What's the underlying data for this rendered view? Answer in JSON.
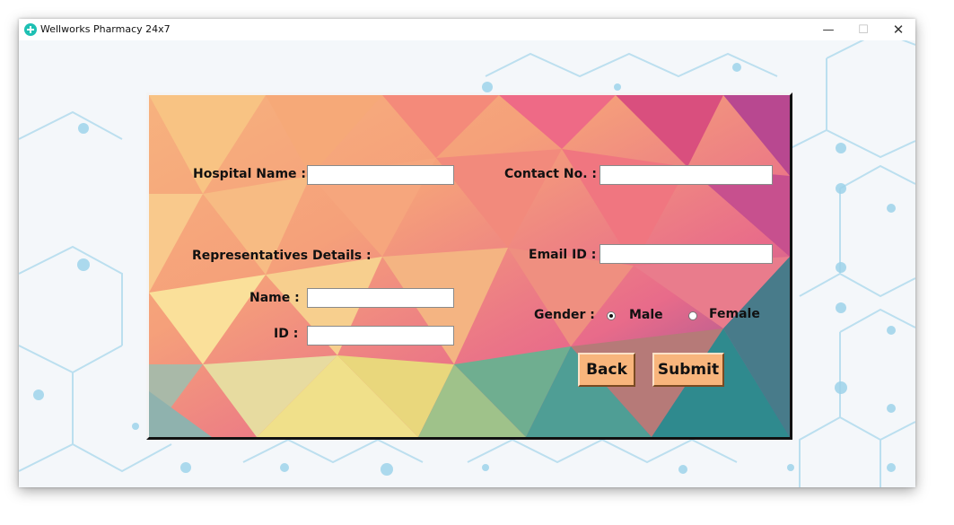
{
  "window": {
    "title": "Wellworks Pharmacy 24x7",
    "controls": {
      "minimize": "—",
      "maximize": "☐",
      "close": "✕"
    }
  },
  "form": {
    "hospital_name_label": "Hospital Name :",
    "contact_no_label": "Contact No. :",
    "representatives_label": "Representatives Details :",
    "email_label": "Email ID :",
    "name_label": "Name :",
    "id_label": "ID :",
    "gender_label": "Gender :",
    "gender_options": [
      "Male",
      "Female"
    ],
    "gender_selected": "Male",
    "values": {
      "hospital_name": "",
      "contact_no": "",
      "email": "",
      "rep_name": "",
      "rep_id": ""
    }
  },
  "buttons": {
    "back": "Back",
    "submit": "Submit"
  },
  "colors": {
    "button_fill": "#f8b57c",
    "app_icon": "#1ec0b3",
    "hex_lines": "#9ed3ea"
  },
  "icons": {
    "app": "medical-cross-icon",
    "minimize": "minimize-icon",
    "maximize": "maximize-icon",
    "close": "close-icon"
  }
}
